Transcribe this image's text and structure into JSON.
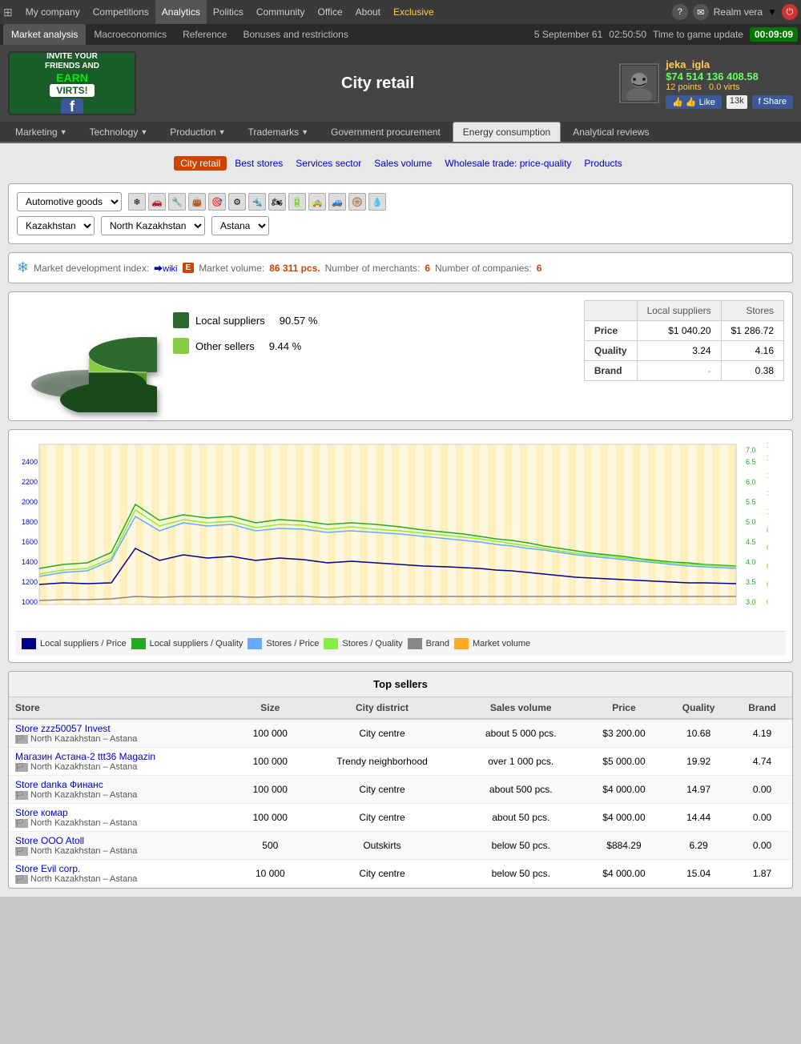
{
  "topNav": {
    "gridIcon": "⊞",
    "links": [
      {
        "label": "My company",
        "active": false
      },
      {
        "label": "Competitions",
        "active": false
      },
      {
        "label": "Analytics",
        "active": true
      },
      {
        "label": "Politics",
        "active": false
      },
      {
        "label": "Community",
        "active": false
      },
      {
        "label": "Office",
        "active": false
      },
      {
        "label": "About",
        "active": false
      },
      {
        "label": "Exclusive",
        "active": false
      }
    ],
    "helpIcon": "?",
    "mailIcon": "✉",
    "userName": "Realm vera",
    "userArrow": "▼",
    "logoutIcon": "⏻"
  },
  "subNav": {
    "links": [
      {
        "label": "Market analysis",
        "active": true
      },
      {
        "label": "Macroeconomics",
        "active": false
      },
      {
        "label": "Reference",
        "active": false
      },
      {
        "label": "Bonuses and restrictions",
        "active": false
      }
    ],
    "date": "5 September 61",
    "time": "02:50:50",
    "timerLabel": "Time to game update",
    "timer": "00:09:09"
  },
  "pageHeader": {
    "bannerLine1": "INVITE YOUR",
    "bannerLine2": "FRIENDS AND",
    "bannerEarn": "EARN",
    "bannerVirts": "VIRTS!",
    "title": "City retail",
    "userName": "jeka_igla",
    "userMoney": "$74 514 136 408.58",
    "userPoints": "12 points",
    "userVirts": "0.0 virts",
    "likeLabel": "👍 Like",
    "likeCount": "13k",
    "shareLabel": "f Share"
  },
  "mainTabs": [
    {
      "label": "Marketing",
      "active": false,
      "hasArrow": true
    },
    {
      "label": "Technology",
      "active": false,
      "hasArrow": true
    },
    {
      "label": "Production",
      "active": false,
      "hasArrow": true
    },
    {
      "label": "Trademarks",
      "active": false,
      "hasArrow": true
    },
    {
      "label": "Government procurement",
      "active": false,
      "hasArrow": false
    },
    {
      "label": "Energy consumption",
      "active": false,
      "hasArrow": false
    },
    {
      "label": "Analytical reviews",
      "active": false,
      "hasArrow": false
    }
  ],
  "subTabs": [
    {
      "label": "City retail",
      "active": true
    },
    {
      "label": "Best stores",
      "active": false
    },
    {
      "label": "Services sector",
      "active": false
    },
    {
      "label": "Sales volume",
      "active": false
    },
    {
      "label": "Wholesale trade: price-quality",
      "active": false
    },
    {
      "label": "Products",
      "active": false
    }
  ],
  "filters": {
    "category": "Automotive goods",
    "country": "Kazakhstan",
    "region": "North Kazakhstan",
    "city": "Astana"
  },
  "marketInfo": {
    "indexLabel": "Market development index:",
    "wikiLabel": "wiki",
    "eBadge": "E",
    "volumeLabel": "Market volume:",
    "volume": "86 311 pcs.",
    "merchantsLabel": "Number of merchants:",
    "merchants": "6",
    "companiesLabel": "Number of companies:",
    "companies": "6"
  },
  "marketDetails": {
    "localSuppliers": {
      "label": "Local suppliers",
      "percent": "90.57 %",
      "color": "#2d6a2d"
    },
    "otherSellers": {
      "label": "Other sellers",
      "percent": "9.44 %",
      "color": "#88cc44"
    },
    "statsHeaders": [
      "Local suppliers",
      "Stores"
    ],
    "statsRows": [
      {
        "label": "Price",
        "localSuppliers": "$1 040.20",
        "stores": "$1 286.72"
      },
      {
        "label": "Quality",
        "localSuppliers": "3.24",
        "stores": "4.16"
      },
      {
        "label": "Brand",
        "localSuppliers": "-",
        "stores": "0.38"
      }
    ]
  },
  "chartLegend": [
    {
      "label": "Local suppliers / Price",
      "color": "#00008b"
    },
    {
      "label": "Local suppliers / Quality",
      "color": "#22aa22"
    },
    {
      "label": "Stores / Price",
      "color": "#66aaff"
    },
    {
      "label": "Stores / Quality",
      "color": "#88ee44"
    },
    {
      "label": "Brand",
      "color": "#888888"
    },
    {
      "label": "Market volume",
      "color": "#ffaa22"
    }
  ],
  "topSellers": {
    "title": "Top sellers",
    "headers": [
      "Store",
      "Size",
      "City district",
      "Sales volume",
      "Price",
      "Quality",
      "Brand"
    ],
    "rows": [
      {
        "storeName": "Store zzz50057 Invest",
        "storeLink": true,
        "location": "North Kazakhstan – Astana",
        "size": "100 000",
        "district": "City centre",
        "salesVolume": "about 5 000 pcs.",
        "price": "$3 200.00",
        "quality": "10.68",
        "brand": "4.19"
      },
      {
        "storeName": "Магазин Астана-2 ttt36 Magazin",
        "storeLink": true,
        "location": "North Kazakhstan – Astana",
        "size": "100 000",
        "district": "Trendy neighborhood",
        "salesVolume": "over 1 000 pcs.",
        "price": "$5 000.00",
        "quality": "19.92",
        "brand": "4.74"
      },
      {
        "storeName": "Store danka Финанс",
        "storeLink": true,
        "location": "North Kazakhstan – Astana",
        "size": "100 000",
        "district": "City centre",
        "salesVolume": "about 500 pcs.",
        "price": "$4 000.00",
        "quality": "14.97",
        "brand": "0.00"
      },
      {
        "storeName": "Store комар",
        "storeLink": true,
        "location": "North Kazakhstan – Astana",
        "size": "100 000",
        "district": "City centre",
        "salesVolume": "about 50 pcs.",
        "price": "$4 000.00",
        "quality": "14.44",
        "brand": "0.00"
      },
      {
        "storeName": "Store OOO Atoll",
        "storeLink": true,
        "location": "North Kazakhstan – Astana",
        "size": "500",
        "district": "Outskirts",
        "salesVolume": "below 50 pcs.",
        "price": "$884.29",
        "quality": "6.29",
        "brand": "0.00"
      },
      {
        "storeName": "Store Evil corp.",
        "storeLink": true,
        "location": "North Kazakhstan – Astana",
        "size": "10 000",
        "district": "City centre",
        "salesVolume": "below 50 pcs.",
        "price": "$4 000.00",
        "quality": "15.04",
        "brand": "1.87"
      }
    ]
  }
}
